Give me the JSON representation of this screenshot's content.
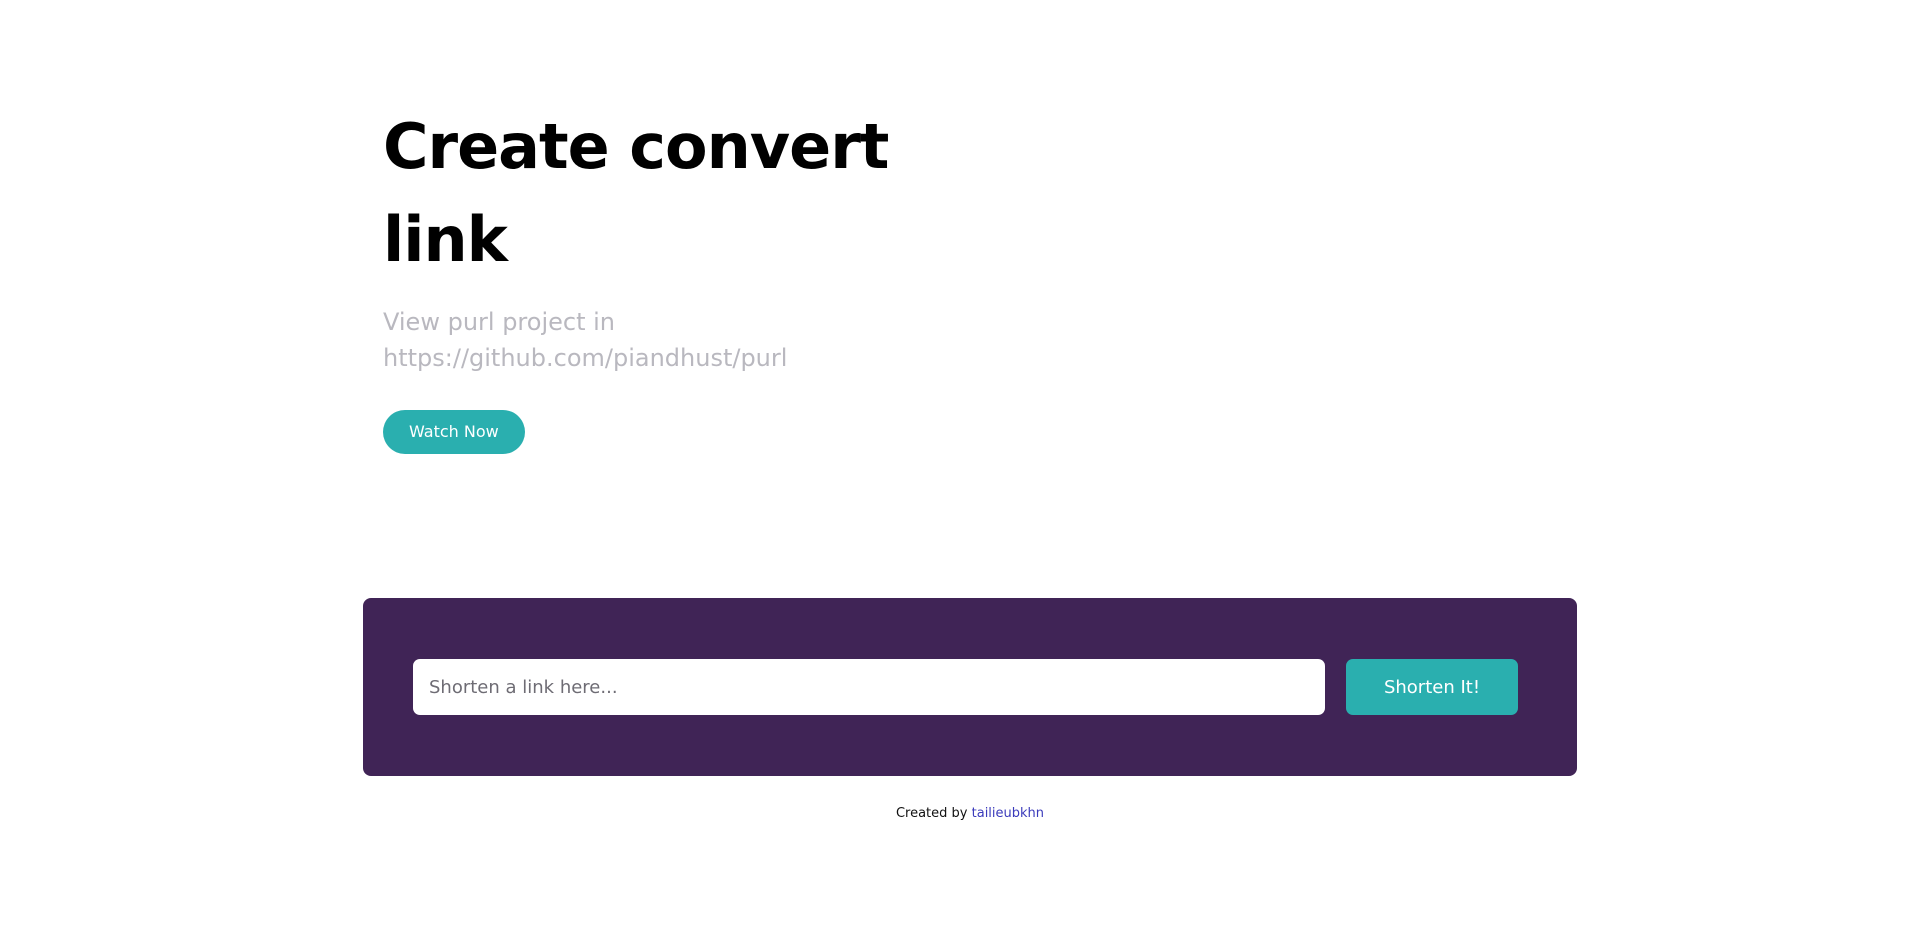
{
  "hero": {
    "title": "Create convert link",
    "subtitle": "View purl project in https://github.com/piandhust/purl",
    "cta_label": "Watch Now"
  },
  "shortener": {
    "input_placeholder": "Shorten a link here...",
    "input_value": "",
    "button_label": "Shorten It!"
  },
  "footer": {
    "prefix": "Created by",
    "author": "tailieubkhn"
  },
  "colors": {
    "accent": "#2aafaf",
    "panel": "#402456",
    "subtitle": "#b9b8bf",
    "link": "#3b3bbb"
  }
}
